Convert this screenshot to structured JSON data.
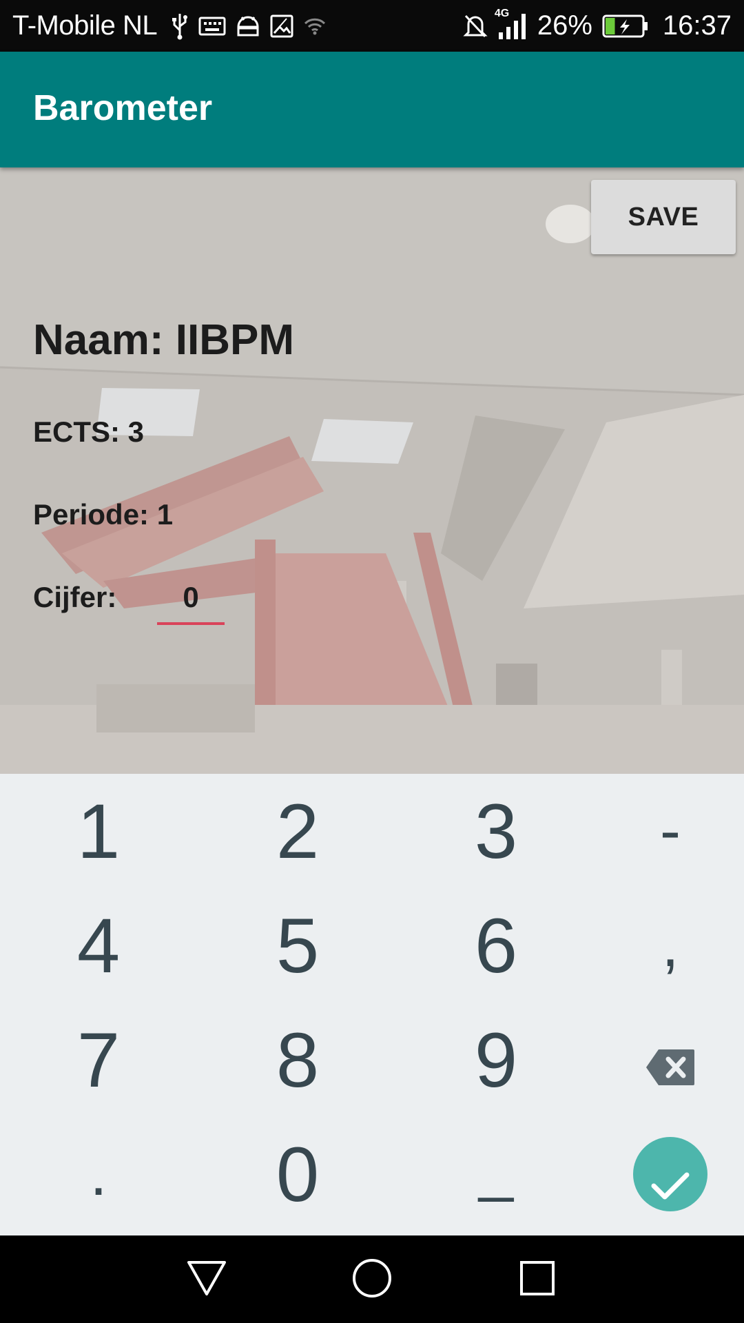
{
  "status_bar": {
    "carrier": "T-Mobile  NL",
    "network_type": "4G",
    "battery_percent": "26%",
    "battery_level": 0.26,
    "time": "16:37",
    "left_icons": [
      "usb-icon",
      "keyboard-icon",
      "android-icon",
      "image-icon",
      "wifi-icon"
    ],
    "right_icons": [
      "mute-icon",
      "signal-icon",
      "battery-charging-icon"
    ]
  },
  "app_bar": {
    "title": "Barometer"
  },
  "form": {
    "save_label": "SAVE",
    "name": "Naam: IIBPM",
    "ects": "ECTS: 3",
    "periode": "Periode: 1",
    "cijfer_label": "Cijfer:",
    "cijfer_value": "0"
  },
  "keypad": {
    "row1": [
      "1",
      "2",
      "3",
      "-"
    ],
    "row2": [
      "4",
      "5",
      "6",
      ","
    ],
    "row3": [
      "7",
      "8",
      "9"
    ],
    "row4": [
      ".",
      "0",
      "_"
    ],
    "backspace_icon": "backspace-icon",
    "done_icon": "check-icon"
  },
  "nav_bar": {
    "icons": [
      "back-icon",
      "home-icon",
      "recents-icon"
    ]
  },
  "colors": {
    "app_bar": "#007d7d",
    "keypad_bg": "#eceff1",
    "key_text": "#37474f",
    "accent_underline": "#d9435a",
    "done_button": "#4db6ac"
  }
}
